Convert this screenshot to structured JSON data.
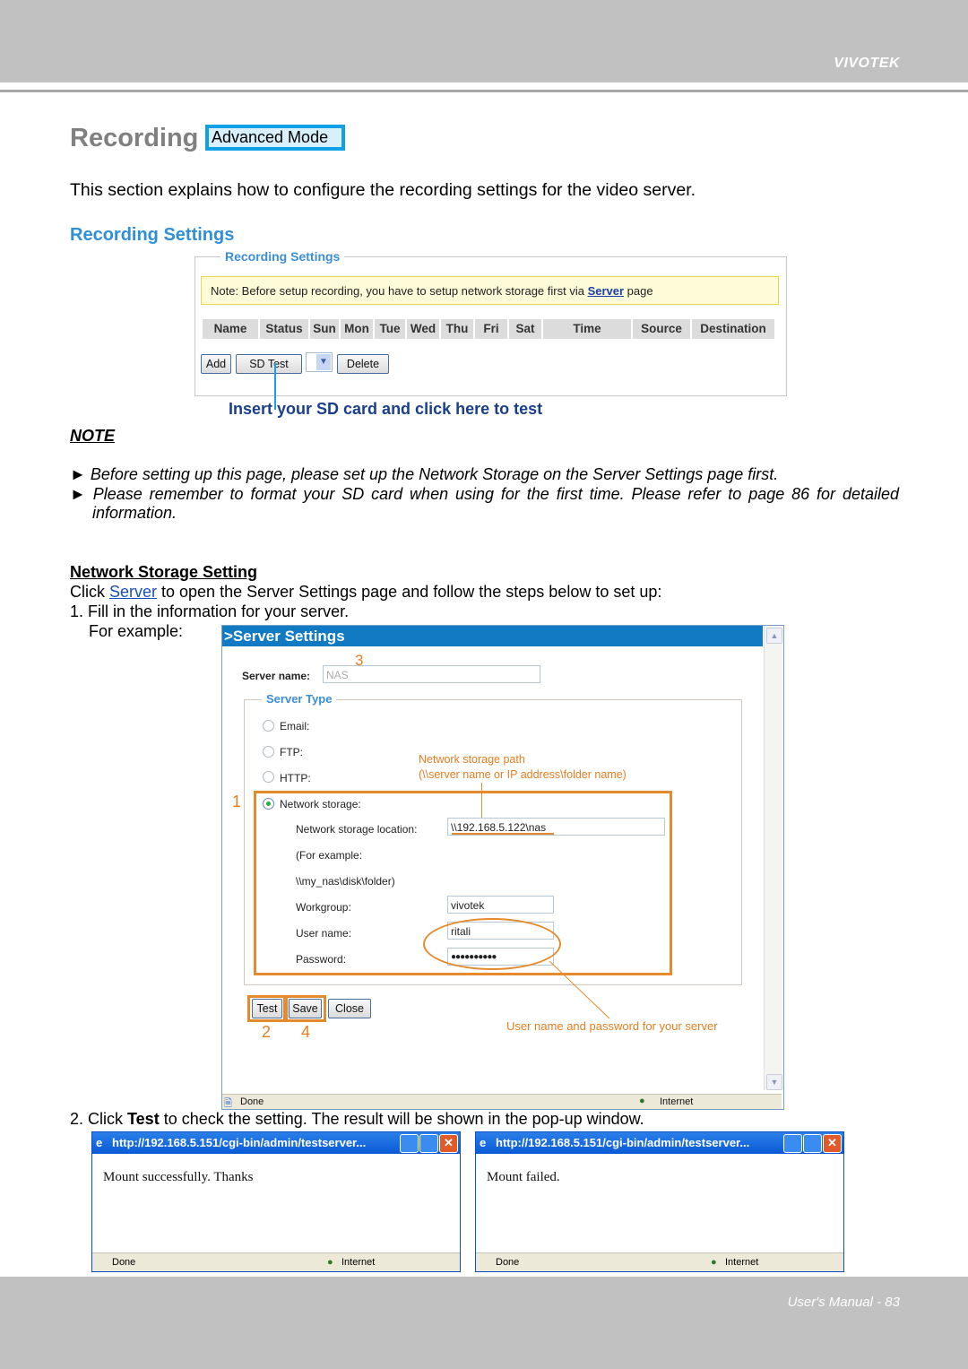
{
  "header": {
    "brand": "VIVOTEK"
  },
  "title": {
    "text": "Recording",
    "badge": "Advanced Mode"
  },
  "intro": "This section explains how to configure the recording settings for the video server.",
  "section_title": "Recording Settings",
  "recording_panel": {
    "legend": "Recording Settings",
    "note_prefix": "Note: Before setup recording, you have to setup network storage first via ",
    "note_link": "Server",
    "note_suffix": " page",
    "columns": [
      "Name",
      "Status",
      "Sun",
      "Mon",
      "Tue",
      "Wed",
      "Thu",
      "Fri",
      "Sat",
      "Time",
      "Source",
      "Destination"
    ],
    "buttons": {
      "add": "Add",
      "sd_test": "SD Test",
      "delete": "Delete"
    },
    "dropdown_icon": "chevron-down-icon",
    "callout": "Insert your SD card and click here to test"
  },
  "note": {
    "heading": "NOTE",
    "bullets": [
      "Before setting up this page, please set up the Network Storage on the Server Settings page first.",
      "Please remember to format your SD card when using for the first time. Please refer to page 86 for detailed information."
    ]
  },
  "network_storage": {
    "heading": "Network Storage Setting",
    "line1_prefix": "Click ",
    "line1_link": "Server",
    "line1_suffix": " to open the Server Settings page and follow the steps below to set up:",
    "step1": "1. Fill in the information for your server.",
    "for_example": "For example:",
    "step2_prefix": "2. Click ",
    "step2_bold": "Test",
    "step2_suffix": " to check the setting. The result will be shown in the pop-up window."
  },
  "server_window": {
    "title": ">Server Settings",
    "server_name_label": "Server name:",
    "server_name_value": "NAS",
    "server_type_legend": "Server Type",
    "types": [
      "Email:",
      "FTP:",
      "HTTP:",
      "Network storage:"
    ],
    "selected_type": "Network storage:",
    "location_label": "Network storage location:",
    "location_value": "\\\\192.168.5.122\\nas",
    "example_line1": "(For example:",
    "example_line2": "\\\\my_nas\\disk\\folder)",
    "workgroup_label": "Workgroup:",
    "workgroup_value": "vivotek",
    "username_label": "User name:",
    "username_value": "ritali",
    "password_label": "Password:",
    "password_value": "●●●●●●●●●●",
    "buttons": {
      "test": "Test",
      "save": "Save",
      "close": "Close"
    },
    "status_done": "Done",
    "status_zone": "Internet",
    "annotations": {
      "step1": "1",
      "step2": "2",
      "step3": "3",
      "step4": "4",
      "path_note_1": "Network storage path",
      "path_note_2": "(\\\\server name or IP address\\folder name)",
      "cred_note": "User name and password for your server"
    }
  },
  "popups": [
    {
      "title": "http://192.168.5.151/cgi-bin/admin/testserver...",
      "message": "Mount successfully. Thanks",
      "status": "Done",
      "zone": "Internet"
    },
    {
      "title": "http://192.168.5.151/cgi-bin/admin/testserver...",
      "message": "Mount failed.",
      "status": "Done",
      "zone": "Internet"
    }
  ],
  "footer": {
    "page_label": "User's Manual - 83"
  },
  "colors": {
    "accent_blue": "#2f8fd8",
    "annotation_orange": "#e68a2e",
    "window_blue": "#117ac3",
    "header_gray": "#c0c1c0"
  }
}
